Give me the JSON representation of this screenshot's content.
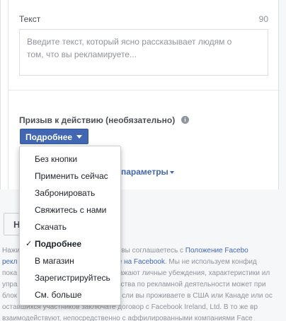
{
  "text_field": {
    "label": "Текст",
    "char_count": "90",
    "placeholder": "Введите текст, который ясно рассказывает людям о\nтом, что вы рекламируете..."
  },
  "cta": {
    "label": "Призыв к действию (необязательно)",
    "info_icon": "i",
    "button_label": "Подробнее"
  },
  "behind": {
    "params_link": "параметры"
  },
  "bottom_button": {
    "label": "Н"
  },
  "legal": {
    "line1_a": "Нажи",
    "line1_b": "аказ», вы соглашаетесь с ",
    "line1_link": "Положение Facebo",
    "line2_link1": "рекл",
    "line2_link2": "ламе на Facebook",
    "line2_b": ". Мы не используем конфид",
    "line3_a": "пока",
    "line3_b": "ажают личные убеждения, характеристики ил",
    "line4_a": "упра",
    "line4_b": "ства по рекламной деятельности может при",
    "line5_a": "блок",
    "line5_b": "сли вы проживаете в США или Канаде или ос",
    "line6": "оставшихся участников заключате договор с Facebook Ireland, Ltd. В то же вр",
    "line7": "взаимодействуют, непосредственно с аффилированными компаниями Face"
  },
  "menu": {
    "items": [
      {
        "label": "Без кнопки",
        "checked": false
      },
      {
        "label": "Применить сейчас",
        "checked": false
      },
      {
        "label": "Забронировать",
        "checked": false
      },
      {
        "label": "Свяжитесь с нами",
        "checked": false
      },
      {
        "label": "Скачать",
        "checked": false
      },
      {
        "label": "Подробнее",
        "checked": true
      },
      {
        "label": "В магазин",
        "checked": false
      },
      {
        "label": "Зарегистрируйтесь",
        "checked": false
      },
      {
        "label": "См. больше",
        "checked": false
      }
    ],
    "check_glyph": "✓"
  },
  "colors": {
    "accent": "#4267b2",
    "text_muted": "#90949c"
  }
}
